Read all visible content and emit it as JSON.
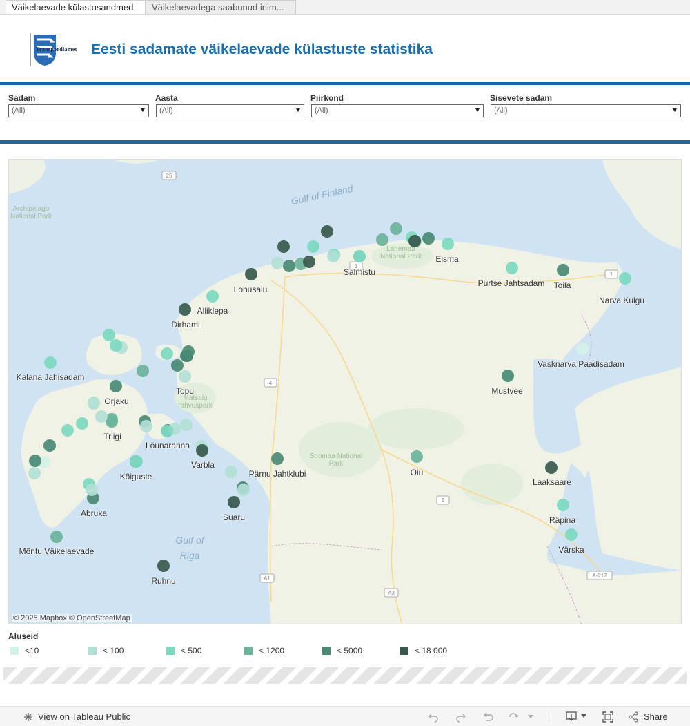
{
  "tabs": [
    {
      "label": "Väikelaevade külastusandmed"
    },
    {
      "label": "Väikelaevadega saabunud inim..."
    }
  ],
  "logo_text": "Transpordiamet",
  "title": "Eesti sadamate väikelaevade külastuste statistika",
  "filters": [
    {
      "label": "Sadam",
      "value": "(All)"
    },
    {
      "label": "Aasta",
      "value": "(All)"
    },
    {
      "label": "Piirkond",
      "value": "(All)"
    },
    {
      "label": "Sisevete sadam",
      "value": "(All)"
    }
  ],
  "map": {
    "sea_labels": [
      "Gulf of Finland",
      "Gulf of Riga"
    ],
    "parks": [
      "Archipelago National Park",
      "Lahemaa National Park",
      "Matsalu rahvuspark",
      "Soomaa National Park"
    ],
    "road_numbers": [
      "25",
      "1",
      "4",
      "3",
      "A1",
      "A3",
      "A-212",
      "1"
    ],
    "place_labels": [
      "Eisma",
      "Salmistu",
      "Lohusalu",
      "Alliklepa",
      "Dirhami",
      "Purtse Jahtsadam",
      "Toila",
      "Narva Kulgu",
      "Vasknarva Paadisadam",
      "Mustvee",
      "Kalana Jahisadam",
      "Orjaku",
      "Topu",
      "Triigi",
      "Lõunaranna",
      "Varbla",
      "Pärnu Jahtklubi",
      "Kõiguste",
      "Oiu",
      "Laaksaare",
      "Abruka",
      "Suaru",
      "Räpina",
      "Mõntu Väikelaevade",
      "Värska",
      "Ruhnu"
    ],
    "credit": "© 2025 Mapbox  © OpenStreetMap"
  },
  "legend": {
    "title": "Aluseid",
    "items": [
      {
        "label": "<10",
        "color": "#d5f2e8"
      },
      {
        "label": "< 100",
        "color": "#b3e0d6"
      },
      {
        "label": "< 500",
        "color": "#7dd9c0"
      },
      {
        "label": "< 1200",
        "color": "#6bb39b"
      },
      {
        "label": "< 5000",
        "color": "#4a8a75"
      },
      {
        "label": "< 18 000",
        "color": "#38594d"
      }
    ]
  },
  "ports": [
    {
      "name": "Eisma",
      "cls": 2
    },
    {
      "name": "Salmistu",
      "cls": 3
    },
    {
      "name": "Lohusalu",
      "cls": 5
    },
    {
      "name": "Alliklepa",
      "cls": 2
    },
    {
      "name": "Dirhami",
      "cls": 5
    },
    {
      "name": "Purtse Jahtsadam",
      "cls": 2
    },
    {
      "name": "Toila",
      "cls": 4
    },
    {
      "name": "Narva Kulgu",
      "cls": 2
    },
    {
      "name": "Vasknarva Paadisadam",
      "cls": 0
    },
    {
      "name": "Mustvee",
      "cls": 4
    },
    {
      "name": "Kalana Jahisadam",
      "cls": 2
    },
    {
      "name": "Orjaku",
      "cls": 1
    },
    {
      "name": "Topu",
      "cls": 1
    },
    {
      "name": "Triigi",
      "cls": 3
    },
    {
      "name": "Lõunaranna",
      "cls": 4
    },
    {
      "name": "Varbla",
      "cls": 2
    },
    {
      "name": "Pärnu Jahtklubi",
      "cls": 4
    },
    {
      "name": "Kõiguste",
      "cls": 3
    },
    {
      "name": "Oiu",
      "cls": 3
    },
    {
      "name": "Laaksaare",
      "cls": 5
    },
    {
      "name": "Abruka",
      "cls": 4
    },
    {
      "name": "Suaru",
      "cls": 5
    },
    {
      "name": "Räpina",
      "cls": 2
    },
    {
      "name": "Mõntu Väikelaevade",
      "cls": 3
    },
    {
      "name": "Värska",
      "cls": 2
    },
    {
      "name": "Ruhnu",
      "cls": 5
    },
    {
      "name": "",
      "cls": 5
    },
    {
      "name": "",
      "cls": 5
    },
    {
      "name": "",
      "cls": 2
    },
    {
      "name": "",
      "cls": 4
    },
    {
      "name": "",
      "cls": 3
    },
    {
      "name": "",
      "cls": 3
    },
    {
      "name": "",
      "cls": 2
    },
    {
      "name": "",
      "cls": 2
    },
    {
      "name": "",
      "cls": 1
    },
    {
      "name": "",
      "cls": 4
    },
    {
      "name": "",
      "cls": 3
    },
    {
      "name": "",
      "cls": 5
    },
    {
      "name": "",
      "cls": 2
    },
    {
      "name": "",
      "cls": 1
    },
    {
      "name": "",
      "cls": 2
    },
    {
      "name": "",
      "cls": 5
    },
    {
      "name": "",
      "cls": 2
    },
    {
      "name": "",
      "cls": 1
    },
    {
      "name": "",
      "cls": 2
    },
    {
      "name": "",
      "cls": 3
    },
    {
      "name": "",
      "cls": 2
    },
    {
      "name": "",
      "cls": 5
    },
    {
      "name": "",
      "cls": 4
    },
    {
      "name": "",
      "cls": 4
    },
    {
      "name": "",
      "cls": 4
    },
    {
      "name": "",
      "cls": 3
    },
    {
      "name": "",
      "cls": 4
    },
    {
      "name": "",
      "cls": 1
    },
    {
      "name": "",
      "cls": 1
    },
    {
      "name": "",
      "cls": 2
    },
    {
      "name": "",
      "cls": 2
    },
    {
      "name": "",
      "cls": 4
    },
    {
      "name": "",
      "cls": 1
    },
    {
      "name": "",
      "cls": 1
    },
    {
      "name": "",
      "cls": 2
    },
    {
      "name": "",
      "cls": 1
    },
    {
      "name": "",
      "cls": 1
    },
    {
      "name": "",
      "cls": 5
    },
    {
      "name": "",
      "cls": 4
    },
    {
      "name": "",
      "cls": 0
    },
    {
      "name": "",
      "cls": 1
    },
    {
      "name": "",
      "cls": 2
    },
    {
      "name": "",
      "cls": 1
    },
    {
      "name": "",
      "cls": 4
    },
    {
      "name": "",
      "cls": 1
    },
    {
      "name": "",
      "cls": 2
    },
    {
      "name": "",
      "cls": 1
    },
    {
      "name": "",
      "cls": 4
    }
  ],
  "footer": {
    "view_label": "View on Tableau Public",
    "share_label": "Share"
  }
}
